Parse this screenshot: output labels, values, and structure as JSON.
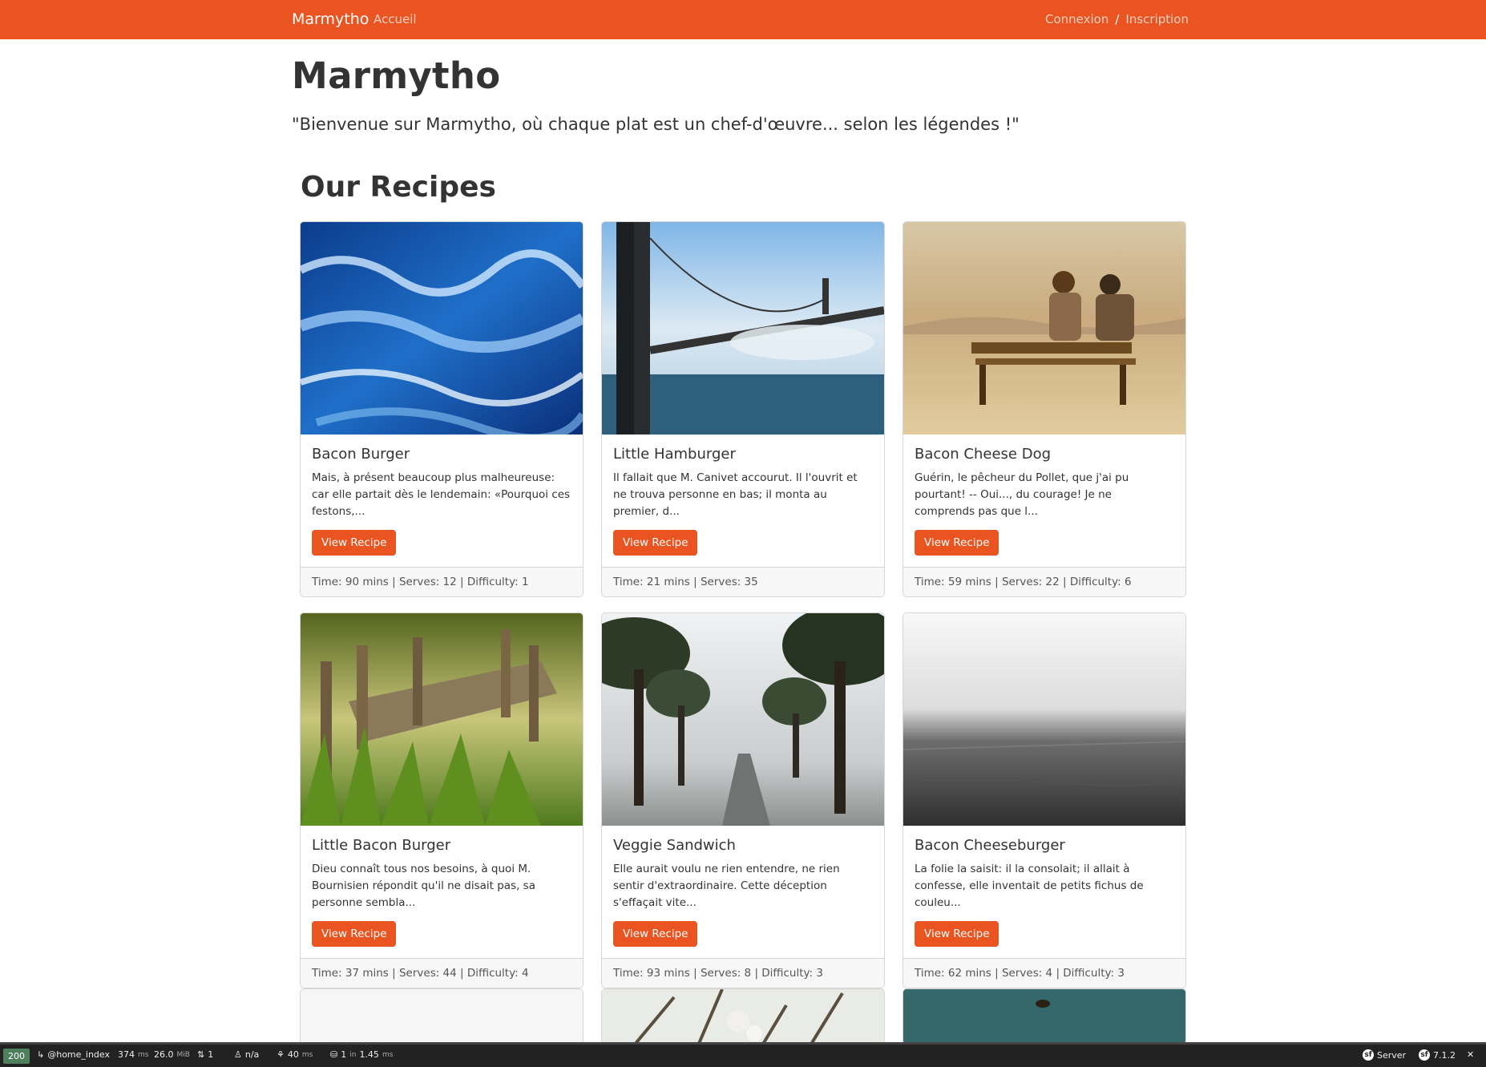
{
  "navbar": {
    "brand": "Marmytho",
    "accueil": "Accueil",
    "connexion": "Connexion",
    "separator": "/",
    "inscription": "Inscription",
    "color": "#e95420"
  },
  "header": {
    "title": "Marmytho",
    "lead": "\"Bienvenue sur Marmytho, où chaque plat est un chef-d'œuvre... selon les légendes !\""
  },
  "section_title": "Our Recipes",
  "recipes": [
    {
      "title": "Bacon Burger",
      "text": "Mais, à présent beaucoup plus malheureuse: car elle partait dès le lendemain: «Pourquoi ces festons,...",
      "button": "View Recipe",
      "footer": "Time: 90 mins | Serves: 12 | Difficulty: 1",
      "image": "ocean-waves"
    },
    {
      "title": "Little Hamburger",
      "text": "Il fallait que M. Canivet accourut. Il l'ouvrit et ne trouva personne en bas; il monta au premier, d...",
      "button": "View Recipe",
      "footer": "Time: 21 mins | Serves: 35",
      "image": "golden-gate-bridge"
    },
    {
      "title": "Bacon Cheese Dog",
      "text": "Guérin, le pêcheur du Pollet, que j'ai pu pourtant! -- Oui..., du courage! Je ne comprends pas que l...",
      "button": "View Recipe",
      "footer": "Time: 59 mins | Serves: 22 | Difficulty: 6",
      "image": "couple-on-bench"
    },
    {
      "title": "Little Bacon Burger",
      "text": "Dieu connaît tous nos besoins, à quoi M. Bournisien répondit qu'il ne disait pas, sa personne sembla...",
      "button": "View Recipe",
      "footer": "Time: 37 mins | Serves: 44 | Difficulty: 4",
      "image": "old-wooden-pier"
    },
    {
      "title": "Veggie Sandwich",
      "text": "Elle aurait voulu ne rien entendre, ne rien sentir d'extraordinaire. Cette déception s'effaçait vite...",
      "button": "View Recipe",
      "footer": "Time: 93 mins | Serves: 8 | Difficulty: 3",
      "image": "foggy-tree-road"
    },
    {
      "title": "Bacon Cheeseburger",
      "text": "La folie la saisit: il la consolait; il allait à confesse, elle inventait de petits fichus de couleu...",
      "button": "View Recipe",
      "footer": "Time: 62 mins | Serves: 4 | Difficulty: 3",
      "image": "misty-sea"
    }
  ],
  "partial_images": [
    "blank",
    "blossom-branch",
    "bird-over-water"
  ],
  "toolbar": {
    "status": "200",
    "route": "@home_index",
    "time": "374",
    "time_unit": "ms",
    "memory": "26.0",
    "memory_unit": "MiB",
    "requests": "1",
    "user": "n/a",
    "render_time": "40",
    "render_unit": "ms",
    "db_queries": "1",
    "db_in": "in",
    "db_time": "1.45",
    "db_unit": "ms",
    "server": "Server",
    "version": "7.1.2"
  }
}
